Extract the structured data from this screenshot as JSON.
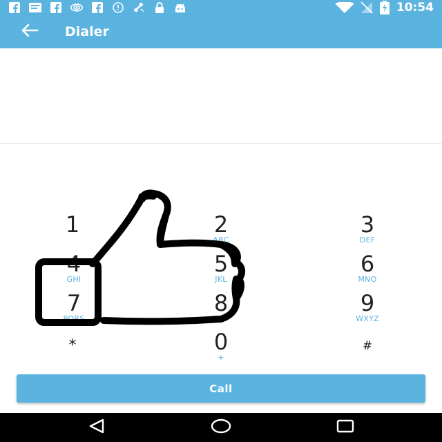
{
  "status_bar": {
    "time": "10:54",
    "left_icons": [
      "facebook-icon",
      "message-icon",
      "facebook-icon",
      "wifi-signal-icon",
      "facebook-icon",
      "info-icon",
      "satellite-icon",
      "lock-icon",
      "android-icon"
    ],
    "right_icons": [
      "wifi-icon",
      "no-signal-icon",
      "battery-charging-icon"
    ]
  },
  "app_bar": {
    "title": "Dialer",
    "back_icon": "arrow-left-icon"
  },
  "display": {
    "number": ""
  },
  "keypad": {
    "keys": [
      {
        "digit": "1",
        "letters": ""
      },
      {
        "digit": "2",
        "letters": "ABC"
      },
      {
        "digit": "3",
        "letters": "DEF"
      },
      {
        "digit": "4",
        "letters": "GHI"
      },
      {
        "digit": "5",
        "letters": "JKL"
      },
      {
        "digit": "6",
        "letters": "MNO"
      },
      {
        "digit": "7",
        "letters": "PQRS"
      },
      {
        "digit": "8",
        "letters": "TUV"
      },
      {
        "digit": "9",
        "letters": "WXYZ"
      },
      {
        "digit": "*",
        "letters": ""
      },
      {
        "digit": "0",
        "letters": "+"
      },
      {
        "digit": "#",
        "letters": ""
      }
    ]
  },
  "call_button": {
    "label": "Call"
  },
  "overlay": {
    "icon": "thumbs-up-icon"
  },
  "nav_bar": {
    "icons": [
      "back-triangle-icon",
      "home-circle-icon",
      "recents-square-icon"
    ]
  },
  "colors": {
    "accent": "#5bb3e0",
    "digit_text": "#222222",
    "nav_background": "#000000"
  }
}
